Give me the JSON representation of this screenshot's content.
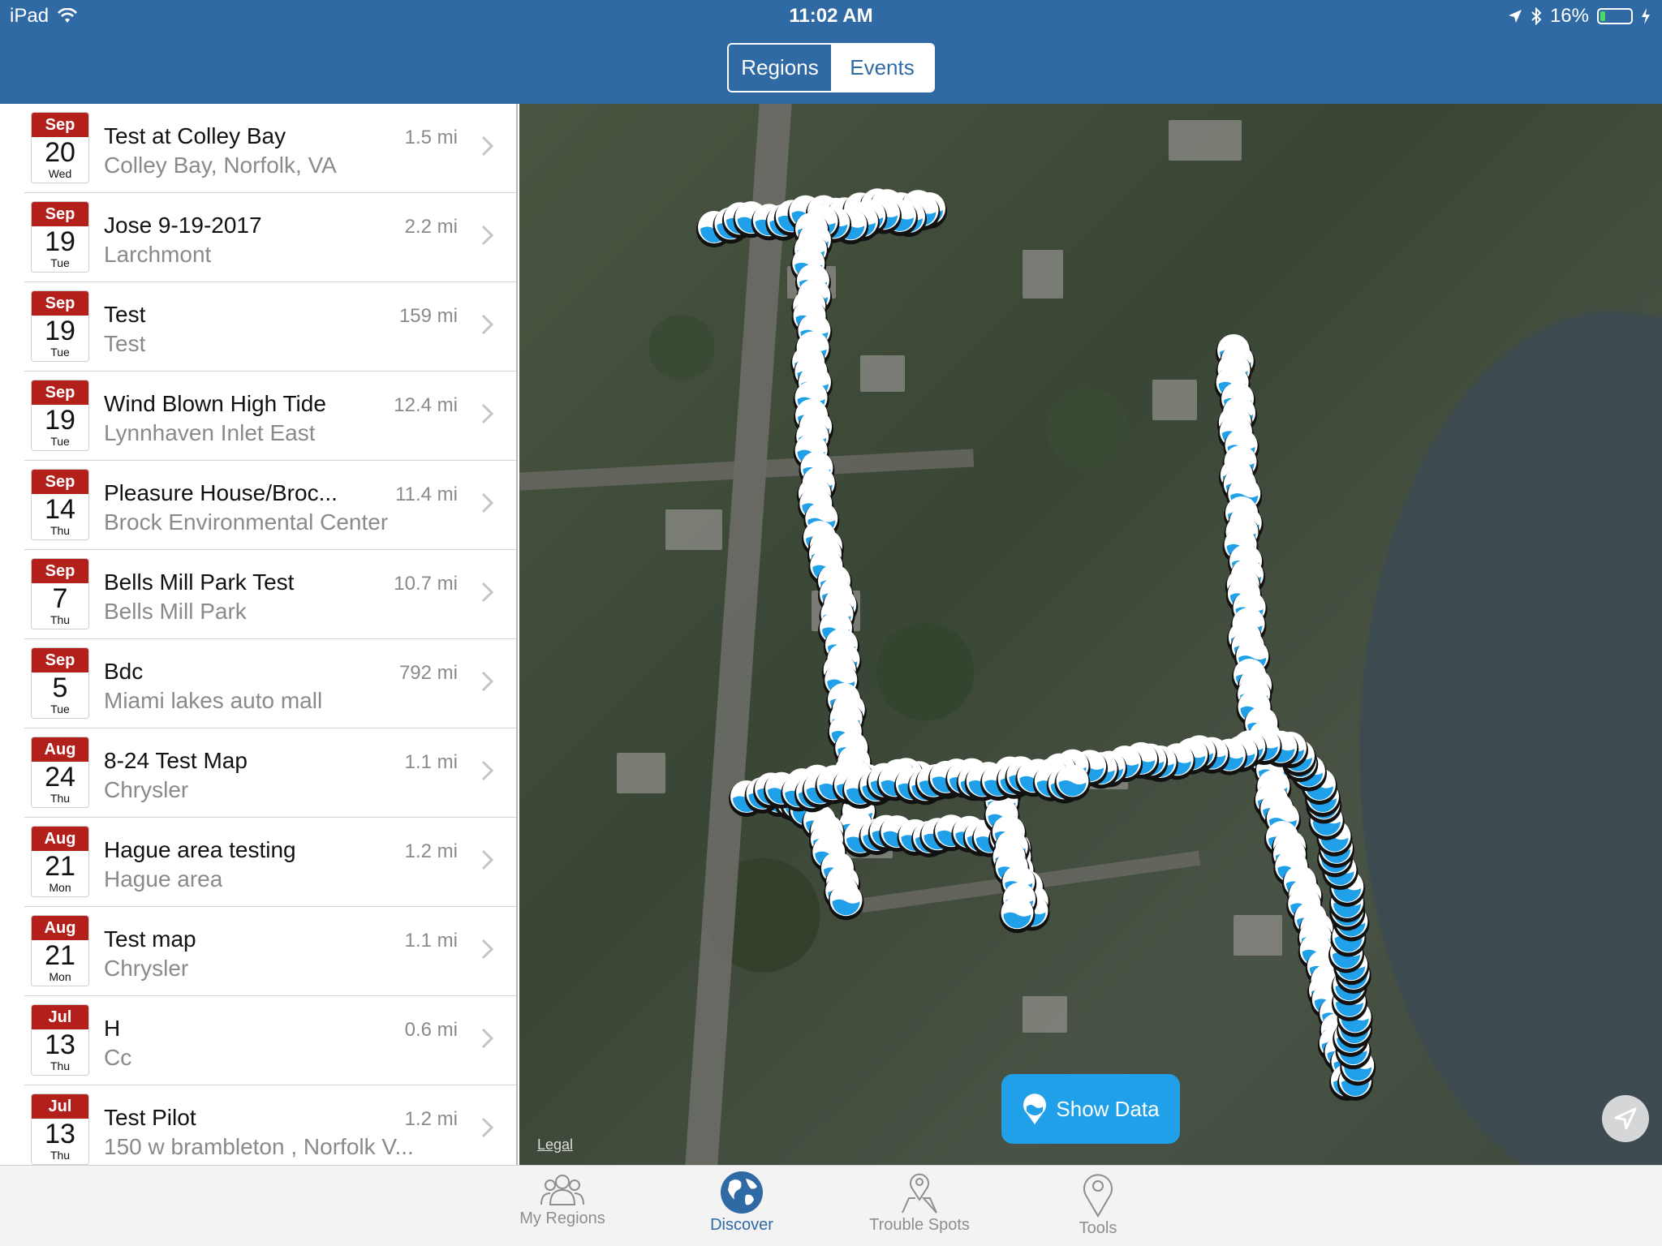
{
  "status_bar": {
    "device": "iPad",
    "time": "11:02 AM",
    "battery": "16%",
    "battery_level": 0.16
  },
  "segments": {
    "regions": "Regions",
    "events": "Events",
    "selected": "events"
  },
  "events": [
    {
      "month": "Sep",
      "day": "20",
      "weekday": "Wed",
      "title": "Test at Colley Bay",
      "location": "Colley Bay, Norfolk, VA",
      "distance": "1.5 mi"
    },
    {
      "month": "Sep",
      "day": "19",
      "weekday": "Tue",
      "title": "Jose 9-19-2017",
      "location": "Larchmont",
      "distance": "2.2 mi"
    },
    {
      "month": "Sep",
      "day": "19",
      "weekday": "Tue",
      "title": "Test",
      "location": "Test",
      "distance": "159 mi"
    },
    {
      "month": "Sep",
      "day": "19",
      "weekday": "Tue",
      "title": "Wind Blown High Tide",
      "location": "Lynnhaven Inlet East",
      "distance": "12.4 mi"
    },
    {
      "month": "Sep",
      "day": "14",
      "weekday": "Thu",
      "title": "Pleasure House/Broc...",
      "location": "Brock Environmental Center",
      "distance": "11.4 mi"
    },
    {
      "month": "Sep",
      "day": "7",
      "weekday": "Thu",
      "title": "Bells Mill Park Test",
      "location": "Bells Mill Park",
      "distance": "10.7 mi"
    },
    {
      "month": "Sep",
      "day": "5",
      "weekday": "Tue",
      "title": "Bdc",
      "location": "Miami lakes auto mall",
      "distance": "792 mi"
    },
    {
      "month": "Aug",
      "day": "24",
      "weekday": "Thu",
      "title": "8-24 Test Map",
      "location": "Chrysler",
      "distance": "1.1 mi"
    },
    {
      "month": "Aug",
      "day": "21",
      "weekday": "Mon",
      "title": "Hague area testing",
      "location": "Hague area",
      "distance": "1.2 mi"
    },
    {
      "month": "Aug",
      "day": "21",
      "weekday": "Mon",
      "title": "Test map",
      "location": "Chrysler",
      "distance": "1.1 mi"
    },
    {
      "month": "Jul",
      "day": "13",
      "weekday": "Thu",
      "title": "H",
      "location": "Cc",
      "distance": "0.6 mi"
    },
    {
      "month": "Jul",
      "day": "13",
      "weekday": "Thu",
      "title": "Test Pilot",
      "location": "150 w brambleton , Norfolk  V...",
      "distance": "1.2 mi"
    }
  ],
  "map": {
    "legal": "Legal",
    "show_data": "Show Data",
    "marker_color": "#1fa0e8"
  },
  "tabs": [
    {
      "label": "My Regions",
      "icon": "people-icon",
      "active": false
    },
    {
      "label": "Discover",
      "icon": "globe-icon",
      "active": true
    },
    {
      "label": "Trouble Spots",
      "icon": "map-pin-icon",
      "active": false
    },
    {
      "label": "Tools",
      "icon": "location-pin-icon",
      "active": false
    }
  ],
  "colors": {
    "header": "#2f6aa5",
    "calendar_red": "#b3201b",
    "accent": "#1fa0e8"
  }
}
